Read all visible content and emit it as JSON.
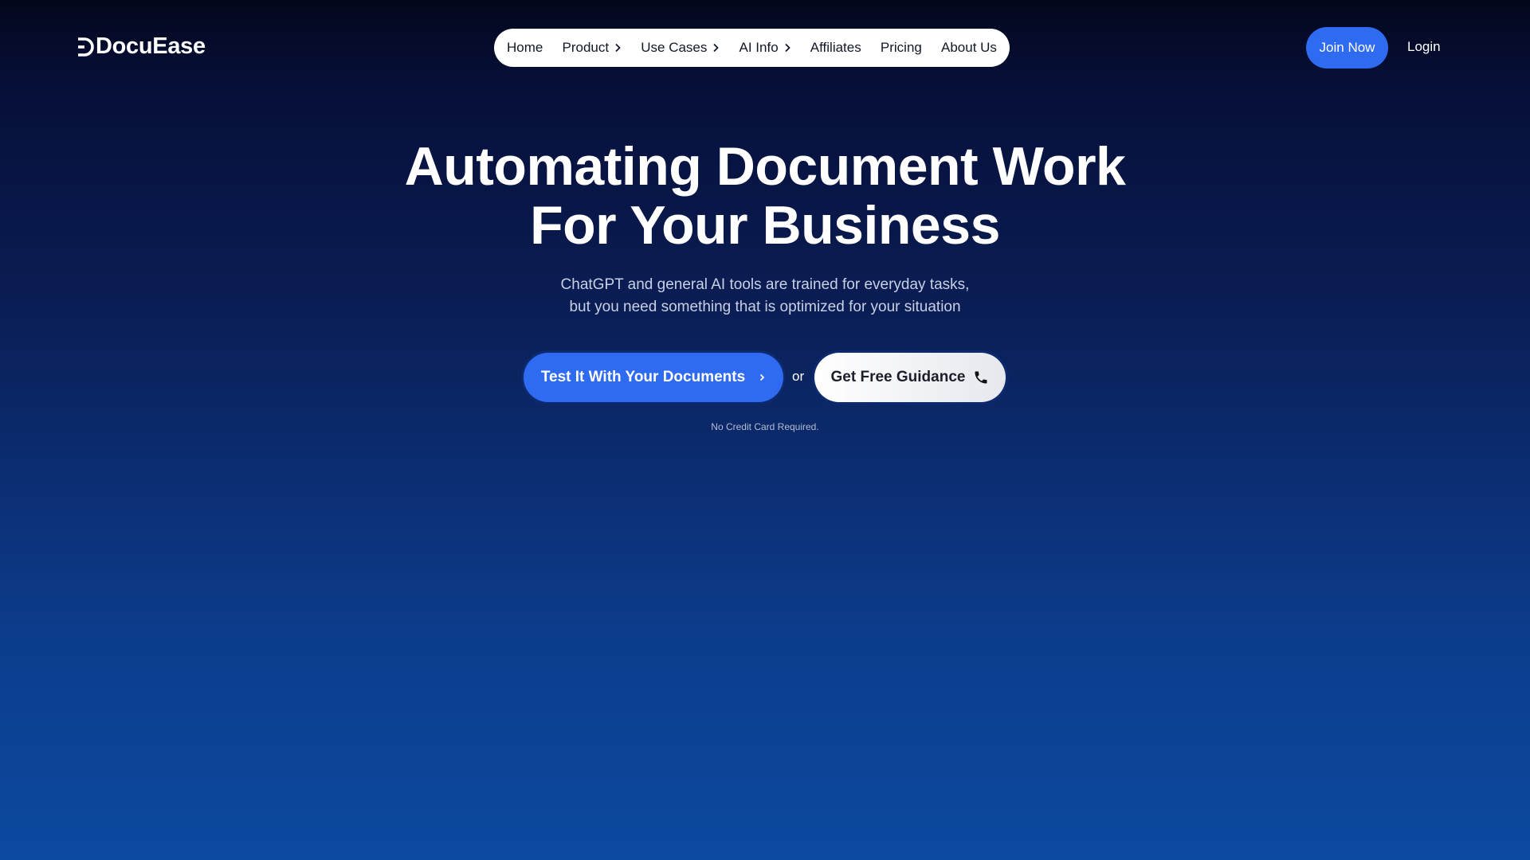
{
  "brand": {
    "name": "DocuEase"
  },
  "nav": {
    "items": [
      {
        "label": "Home",
        "has_chevron": false
      },
      {
        "label": "Product",
        "has_chevron": true
      },
      {
        "label": "Use Cases",
        "has_chevron": true
      },
      {
        "label": "AI Info",
        "has_chevron": true
      },
      {
        "label": "Affiliates",
        "has_chevron": false
      },
      {
        "label": "Pricing",
        "has_chevron": false
      },
      {
        "label": "About Us",
        "has_chevron": false
      }
    ]
  },
  "header": {
    "join_label": "Join Now",
    "login_label": "Login"
  },
  "hero": {
    "title_line1": "Automating Document Work",
    "title_line2": "For Your Business",
    "subtitle_line1": "ChatGPT and general AI tools are trained for everyday tasks,",
    "subtitle_line2": "but you need something that is optimized for your situation",
    "primary_cta": "Test It With Your Documents",
    "or_text": "or",
    "secondary_cta": "Get Free Guidance",
    "note": "No Credit Card Required."
  },
  "icons": {
    "primary_cta_icon": "chevron-right-icon",
    "secondary_cta_icon": "phone-icon",
    "nav_dropdown_icon": "chevron-right-icon"
  },
  "colors": {
    "accent": "#2f6bf1",
    "background_top": "#03071c",
    "background_bottom": "#0c4aa0"
  }
}
